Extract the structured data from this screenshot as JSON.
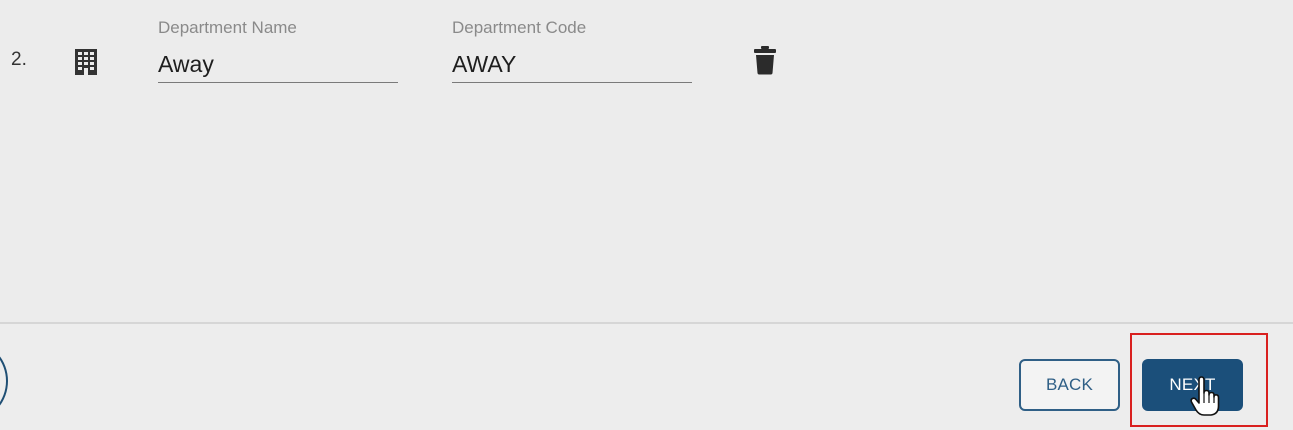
{
  "department_row": {
    "number": "2.",
    "icon": "building-icon",
    "name_field": {
      "label": "Department Name",
      "value": "Away"
    },
    "code_field": {
      "label": "Department Code",
      "value": "AWAY"
    },
    "delete_icon": "trash-icon"
  },
  "footer": {
    "back_label": "BACK",
    "next_label": "NEXT"
  },
  "colors": {
    "background": "#ececec",
    "primary": "#1b4f7a",
    "outline": "#2f5f86",
    "highlight": "#d9201f"
  },
  "cursor": "hand-pointer-icon"
}
